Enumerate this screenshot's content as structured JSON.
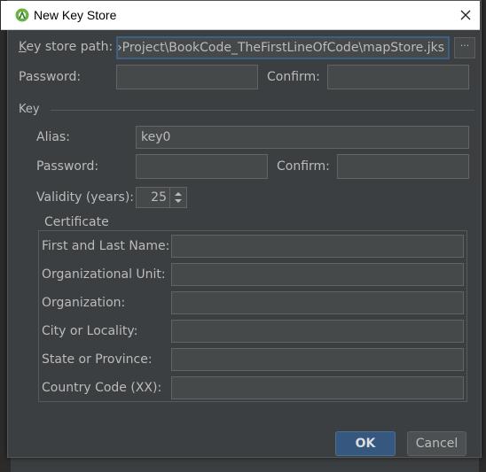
{
  "window": {
    "title": "New Key Store",
    "close_glyph": "✕"
  },
  "keystore": {
    "path_label": "Key store path:",
    "path_value": "›Project\\BookCode_TheFirstLineOfCode\\mapStore.jks",
    "browse_label": "···",
    "password_label": "Password:",
    "confirm_label": "Confirm:"
  },
  "key": {
    "section_label": "Key",
    "alias_label": "Alias:",
    "alias_value": "key0",
    "password_label": "Password:",
    "confirm_label": "Confirm:",
    "validity_label": "Validity (years):",
    "validity_value": "25"
  },
  "certificate": {
    "title": "Certificate",
    "fields": [
      {
        "label": "First and Last Name:",
        "value": ""
      },
      {
        "label": "Organizational Unit:",
        "value": ""
      },
      {
        "label": "Organization:",
        "value": ""
      },
      {
        "label": "City or Locality:",
        "value": ""
      },
      {
        "label": "State or Province:",
        "value": ""
      },
      {
        "label": "Country Code (XX):",
        "value": ""
      }
    ]
  },
  "buttons": {
    "ok": "OK",
    "cancel": "Cancel"
  },
  "colors": {
    "background": "#3c3f41",
    "ok_button": "#365880",
    "focus_border": "#3d6185"
  }
}
